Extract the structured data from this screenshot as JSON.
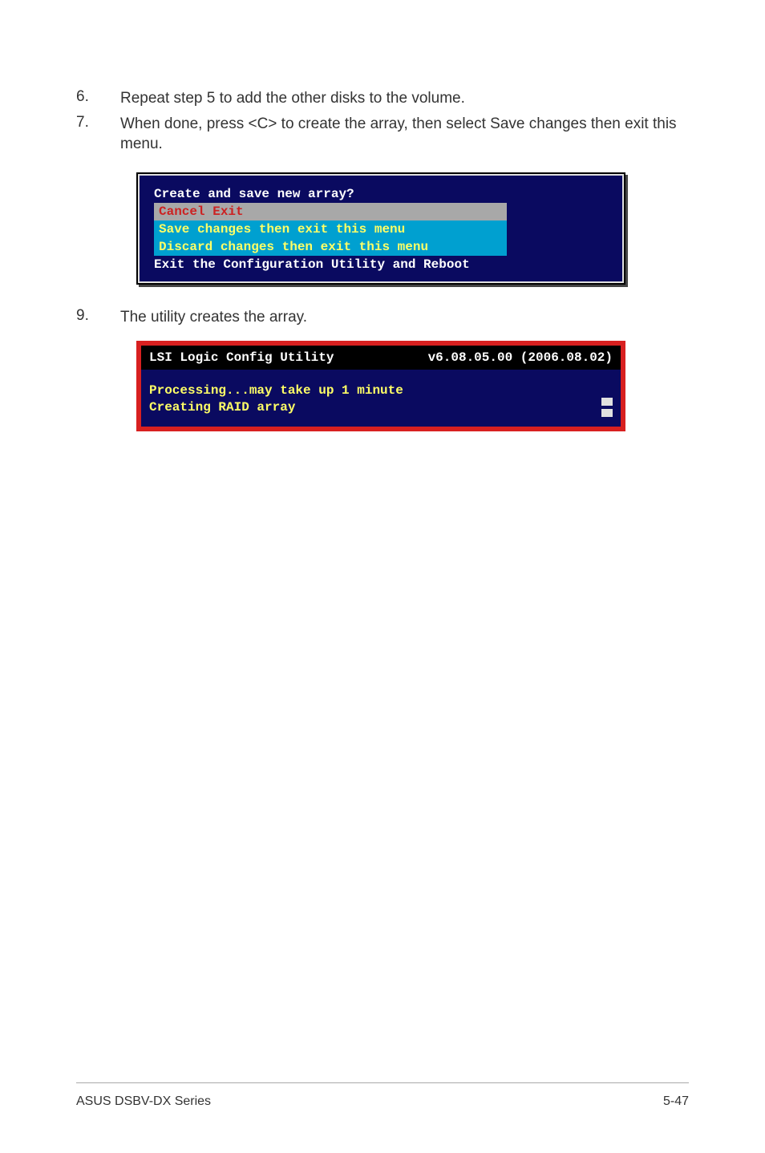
{
  "steps": [
    {
      "num": "6.",
      "text": "Repeat step 5 to add the other disks to the volume."
    },
    {
      "num": "7.",
      "text": "When done, press <C> to create the array, then select Save changes then exit this menu."
    },
    {
      "num": "9.",
      "text": "The utility creates the array."
    }
  ],
  "bios_menu": {
    "heading": "Create and save new array?",
    "items": [
      {
        "label": "Cancel Exit",
        "class": "selected"
      },
      {
        "label": "Save changes then exit this menu",
        "class": "highlight"
      },
      {
        "label": "Discard changes then exit this menu",
        "class": "highlight"
      }
    ],
    "footer": "Exit the Configuration Utility and Reboot"
  },
  "util": {
    "title": "LSI Logic Config Utility",
    "version": "v6.08.05.00 (2006.08.02)",
    "line1": "Processing...may take up 1 minute",
    "line2": "Creating RAID array"
  },
  "footer": {
    "left": "ASUS DSBV-DX Series",
    "right": "5-47"
  }
}
